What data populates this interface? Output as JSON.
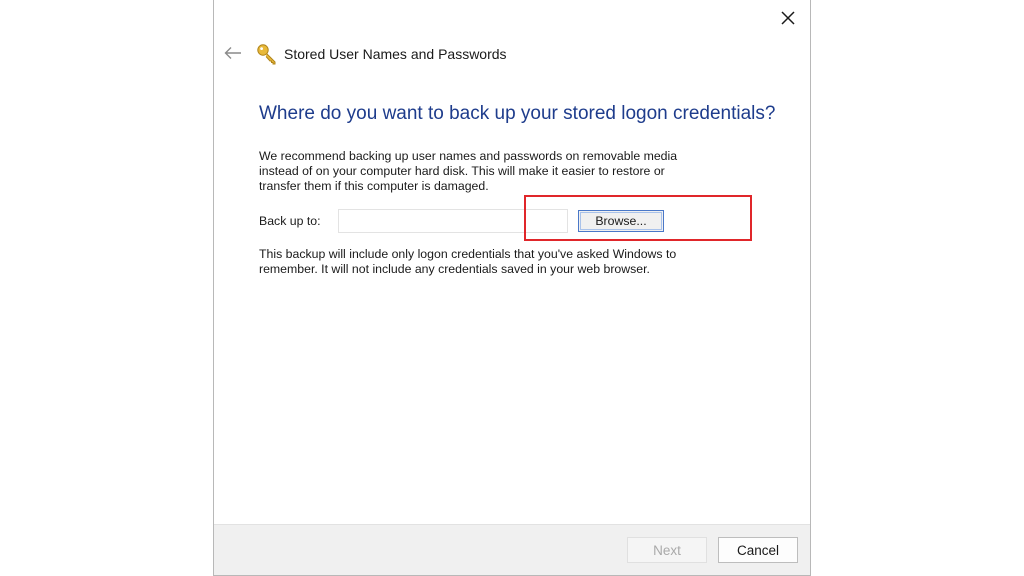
{
  "window": {
    "title": "Stored User Names and Passwords",
    "close_icon": "close-icon",
    "back_icon": "back-arrow-icon",
    "app_icon": "key-icon"
  },
  "main": {
    "heading": "Where do you want to back up your stored logon credentials?",
    "intro_lines": [
      "We recommend backing up user names and passwords on removable media",
      "instead of on your computer hard disk. This will make it easier to restore or",
      "transfer them if this computer is damaged."
    ],
    "backup_label": "Back up to:",
    "backup_value": "",
    "browse_label": "Browse...",
    "note_lines": [
      "This backup will include only logon credentials that you've asked Windows to",
      "remember. It will not include any credentials saved in your web browser."
    ]
  },
  "footer": {
    "next_label": "Next",
    "cancel_label": "Cancel"
  },
  "colors": {
    "heading": "#1e3c8c",
    "highlight": "#e0262a",
    "footer_bg": "#f0f0f0"
  }
}
